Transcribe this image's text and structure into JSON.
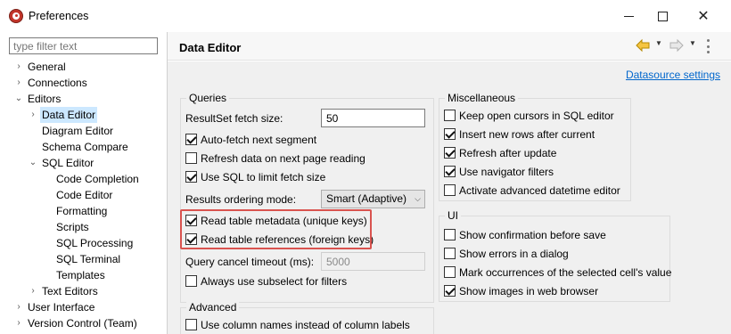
{
  "window": {
    "title": "Preferences"
  },
  "filter": {
    "placeholder": "type filter text"
  },
  "tree": [
    {
      "label": "General",
      "arrow": "›",
      "selected": false
    },
    {
      "label": "Connections",
      "arrow": "›",
      "selected": false
    },
    {
      "label": "Editors",
      "arrow": "⌄",
      "selected": false
    },
    {
      "label": "Data Editor",
      "arrow": "›",
      "selected": true
    },
    {
      "label": "Diagram Editor",
      "arrow": "",
      "selected": false
    },
    {
      "label": "Schema Compare",
      "arrow": "",
      "selected": false
    },
    {
      "label": "SQL Editor",
      "arrow": "⌄",
      "selected": false
    },
    {
      "label": "Code Completion",
      "arrow": "",
      "selected": false
    },
    {
      "label": "Code Editor",
      "arrow": "",
      "selected": false
    },
    {
      "label": "Formatting",
      "arrow": "",
      "selected": false
    },
    {
      "label": "Scripts",
      "arrow": "",
      "selected": false
    },
    {
      "label": "SQL Processing",
      "arrow": "",
      "selected": false
    },
    {
      "label": "SQL Terminal",
      "arrow": "",
      "selected": false
    },
    {
      "label": "Templates",
      "arrow": "",
      "selected": false
    },
    {
      "label": "Text Editors",
      "arrow": "›",
      "selected": false
    },
    {
      "label": "User Interface",
      "arrow": "›",
      "selected": false
    },
    {
      "label": "Version Control (Team)",
      "arrow": "›",
      "selected": false
    }
  ],
  "page": {
    "title": "Data Editor",
    "datasource_link": "Datasource settings"
  },
  "queries": {
    "title": "Queries",
    "fetch_size_label": "ResultSet fetch size:",
    "fetch_size_value": "50",
    "auto_fetch": {
      "label": "Auto-fetch next segment",
      "checked": true
    },
    "refresh_next_page": {
      "label": "Refresh data on next page reading",
      "checked": false
    },
    "use_sql_limit": {
      "label": "Use SQL to limit fetch size",
      "checked": true
    },
    "ordering_label": "Results ordering mode:",
    "ordering_value": "Smart (Adaptive)",
    "read_metadata": {
      "label": "Read table metadata (unique keys)",
      "checked": true
    },
    "read_references": {
      "label": "Read table references (foreign keys)",
      "checked": true
    },
    "cancel_timeout_label": "Query cancel timeout (ms):",
    "cancel_timeout_value": "5000",
    "always_subselect": {
      "label": "Always use subselect for filters",
      "checked": false
    }
  },
  "misc": {
    "title": "Miscellaneous",
    "items": [
      {
        "label": "Keep open cursors in SQL editor",
        "checked": false
      },
      {
        "label": "Insert new rows after current",
        "checked": true
      },
      {
        "label": "Refresh after update",
        "checked": true
      },
      {
        "label": "Use navigator filters",
        "checked": true
      },
      {
        "label": "Activate advanced datetime editor",
        "checked": false
      }
    ]
  },
  "ui": {
    "title": "UI",
    "items": [
      {
        "label": "Show confirmation before save",
        "checked": false
      },
      {
        "label": "Show errors in a dialog",
        "checked": false
      },
      {
        "label": "Mark occurrences of the selected cell's value",
        "checked": false
      },
      {
        "label": "Show images in web browser",
        "checked": true
      }
    ]
  },
  "advanced": {
    "title": "Advanced",
    "column_names": {
      "label": "Use column names instead of column labels",
      "checked": false
    }
  },
  "colors": {
    "highlight": "#d9534f",
    "selection": "#cce8ff",
    "link": "#0066cc"
  },
  "icons": {
    "back": "arrow-left-icon",
    "forward": "arrow-right-icon",
    "menu": "vertical-dots-icon"
  }
}
